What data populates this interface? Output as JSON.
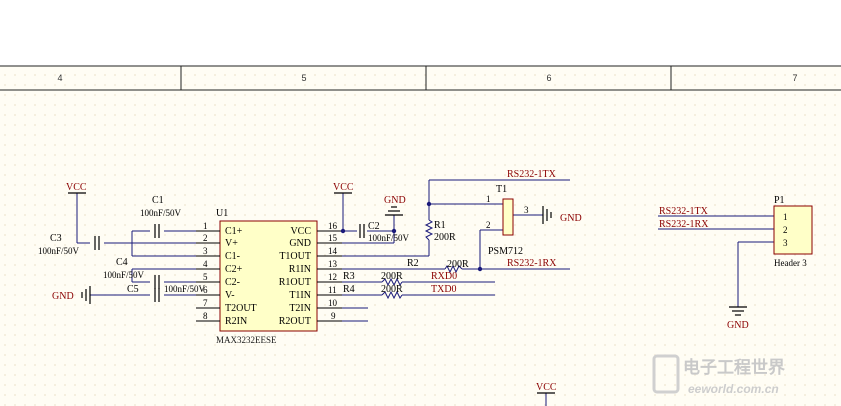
{
  "zones": [
    "4",
    "5",
    "6",
    "7"
  ],
  "ic": {
    "designator": "U1",
    "part": "MAX3232EESE",
    "left_pins": [
      {
        "num": "1",
        "name": "C1+"
      },
      {
        "num": "2",
        "name": "V+"
      },
      {
        "num": "3",
        "name": "C1-"
      },
      {
        "num": "4",
        "name": "C2+"
      },
      {
        "num": "5",
        "name": "C2-"
      },
      {
        "num": "6",
        "name": "V-"
      },
      {
        "num": "7",
        "name": "T2OUT"
      },
      {
        "num": "8",
        "name": "R2IN"
      }
    ],
    "right_pins": [
      {
        "num": "16",
        "name": "VCC"
      },
      {
        "num": "15",
        "name": "GND"
      },
      {
        "num": "14",
        "name": "T1OUT"
      },
      {
        "num": "13",
        "name": "R1IN"
      },
      {
        "num": "12",
        "name": "R1OUT"
      },
      {
        "num": "11",
        "name": "T1IN"
      },
      {
        "num": "10",
        "name": "T2IN"
      },
      {
        "num": "9",
        "name": "R2OUT"
      }
    ]
  },
  "capacitors": {
    "c1": {
      "ref": "C1",
      "value": "100nF/50V"
    },
    "c2": {
      "ref": "C2",
      "value": "100nF/50V"
    },
    "c3": {
      "ref": "C3",
      "value": "100nF/50V"
    },
    "c4": {
      "ref": "C4",
      "value": "100nF/50V"
    },
    "c5": {
      "ref": "C5",
      "value": "100nF/50V"
    }
  },
  "resistors": {
    "r1": {
      "ref": "R1",
      "value": "200R"
    },
    "r2": {
      "ref": "R2",
      "value": "200R"
    },
    "r3": {
      "ref": "R3",
      "value": "200R"
    },
    "r4": {
      "ref": "R4",
      "value": "200R"
    }
  },
  "power": {
    "vcc": "VCC",
    "gnd": "GND"
  },
  "tvs": {
    "ref": "T1",
    "part": "PSM712",
    "pins": [
      "1",
      "2",
      "3"
    ]
  },
  "header": {
    "ref": "P1",
    "part": "Header 3",
    "pins": [
      "1",
      "2",
      "3"
    ]
  },
  "nets": {
    "tx": "RS232-1TX",
    "rx": "RS232-1RX",
    "rxd": "RXD0",
    "txd": "TXD0"
  },
  "watermark": {
    "cn": "电子工程世界",
    "en": "eeworld.com.cn"
  }
}
